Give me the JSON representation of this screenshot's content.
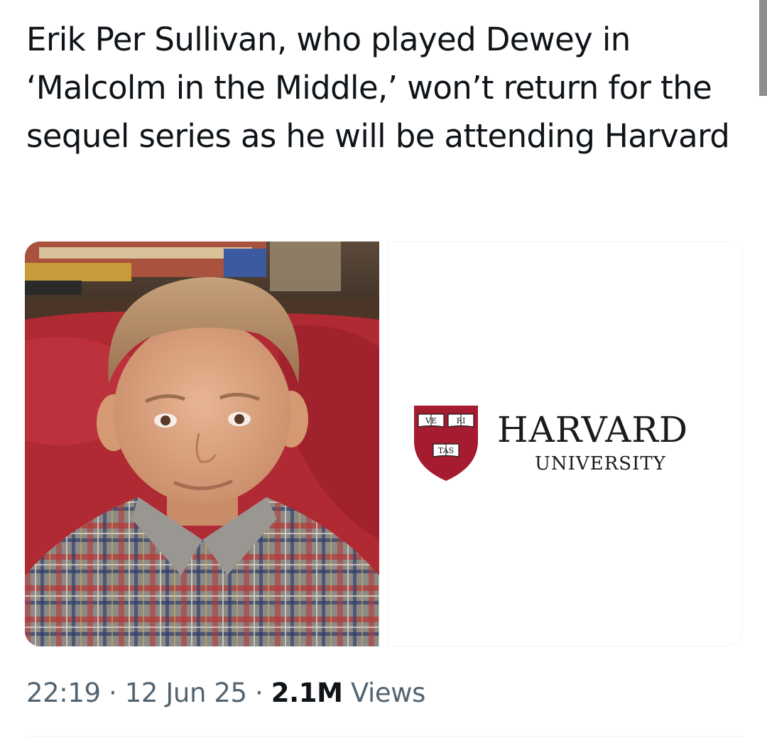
{
  "tweet": {
    "text": "Erik Per Sullivan, who played Dewey in ‘Malcolm in the Middle,’ won’t return for the sequel series as he will be attending Harvard"
  },
  "media": {
    "logo": {
      "name": "HARVARD",
      "subtitle": "UNIVERSITY",
      "shield_words": [
        "VE",
        "RI",
        "TAS"
      ],
      "colors": {
        "shield": "#a51c30",
        "text": "#1a1a1a"
      }
    }
  },
  "meta": {
    "time": "22:19",
    "separator": "·",
    "date": "12 Jun 25",
    "views_count": "2.1M",
    "views_label": "Views"
  },
  "colors": {
    "text_primary": "#0f1419",
    "text_secondary": "#536471",
    "divider": "#eff3f4"
  }
}
